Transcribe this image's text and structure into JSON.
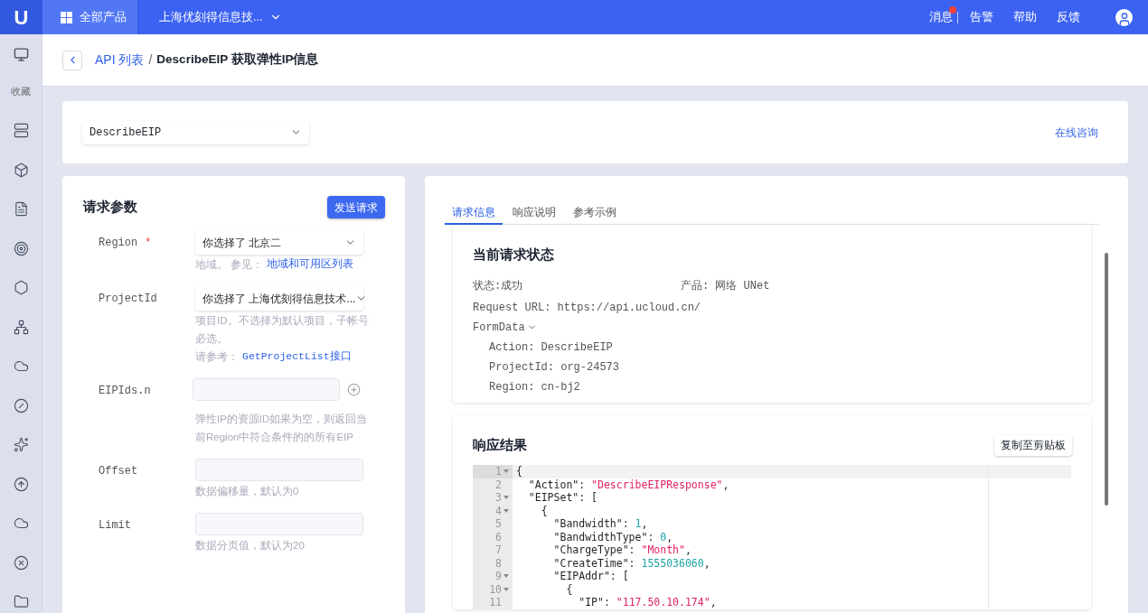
{
  "topbar": {
    "logo": "U",
    "all_products": "全部产品",
    "org": "上海优刻得信息技...",
    "links": [
      {
        "label": "消息",
        "badge": true,
        "divider": true
      },
      {
        "label": "告警",
        "badge": false,
        "divider": false
      },
      {
        "label": "帮助",
        "badge": false,
        "divider": false
      },
      {
        "label": "反馈",
        "badge": false,
        "divider": false
      }
    ]
  },
  "sidebar": {
    "favorites": "收藏"
  },
  "breadcrumb": {
    "parent": "API 列表",
    "separator": "/",
    "current": "DescribeEIP 获取弹性IP信息"
  },
  "api_select": {
    "value": "DescribeEIP"
  },
  "consult_link": "在线咨询",
  "request_params": {
    "title": "请求参数",
    "required_mark": "*",
    "send_button": "发送请求",
    "fields": [
      {
        "kind": "select",
        "label": "Region",
        "required": true,
        "value": "你选择了  北京二",
        "help": [
          {
            "text": "地域。 参见：",
            "link": "地域和可用区列表"
          }
        ]
      },
      {
        "kind": "select",
        "label": "ProjectId",
        "required": false,
        "value": "你选择了  上海优刻得信息技术...",
        "help": [
          {
            "text": "项目ID。不选择为默认项目，子帐号必选。"
          },
          {
            "text": "请参考：",
            "link": "GetProjectList接口"
          }
        ]
      },
      {
        "kind": "list",
        "label": "EIPIds.n",
        "required": false,
        "help": [
          {
            "text": "弹性IP的资源ID如果为空，则返回当前Region中符合条件的的所有EIP"
          }
        ]
      },
      {
        "kind": "input",
        "label": "Offset",
        "required": false,
        "help": [
          {
            "text": "数据偏移量，默认为0"
          }
        ]
      },
      {
        "kind": "input",
        "label": "Limit",
        "required": false,
        "help": [
          {
            "text": "数据分页值，默认为20"
          }
        ]
      }
    ]
  },
  "tabs": [
    {
      "label": "请求信息",
      "selected": true
    },
    {
      "label": "响应说明",
      "selected": false
    },
    {
      "label": "参考示例",
      "selected": false
    }
  ],
  "request_status": {
    "title": "当前请求状态",
    "status": "状态:成功",
    "product": "产品: 网络 UNet",
    "url": "Request URL: https://api.ucloud.cn/",
    "form_data": {
      "label": "FormData",
      "expanded": true,
      "entries": [
        "Action: DescribeEIP",
        "ProjectId: org-24573",
        "Region: cn-bj2"
      ]
    }
  },
  "response": {
    "title": "响应结果",
    "copy_button": "复制至剪贴板",
    "lines": [
      {
        "number": "1",
        "fold": true,
        "active": true,
        "tokens": [
          {
            "kind": "punct",
            "text": "{"
          }
        ]
      },
      {
        "number": "2",
        "fold": false,
        "active": false,
        "tokens": [
          {
            "kind": "punct",
            "text": "  \"Action\": "
          },
          {
            "kind": "string",
            "text": "\"DescribeEIPResponse\""
          },
          {
            "kind": "punct",
            "text": ","
          }
        ]
      },
      {
        "number": "3",
        "fold": true,
        "active": false,
        "tokens": [
          {
            "kind": "punct",
            "text": "  \"EIPSet\": ["
          }
        ]
      },
      {
        "number": "4",
        "fold": true,
        "active": false,
        "tokens": [
          {
            "kind": "punct",
            "text": "    {"
          }
        ]
      },
      {
        "number": "5",
        "fold": false,
        "active": false,
        "tokens": [
          {
            "kind": "punct",
            "text": "      \"Bandwidth\": "
          },
          {
            "kind": "number",
            "text": "1"
          },
          {
            "kind": "punct",
            "text": ","
          }
        ]
      },
      {
        "number": "6",
        "fold": false,
        "active": false,
        "tokens": [
          {
            "kind": "punct",
            "text": "      \"BandwidthType\": "
          },
          {
            "kind": "number",
            "text": "0"
          },
          {
            "kind": "punct",
            "text": ","
          }
        ]
      },
      {
        "number": "7",
        "fold": false,
        "active": false,
        "tokens": [
          {
            "kind": "punct",
            "text": "      \"ChargeType\": "
          },
          {
            "kind": "string",
            "text": "\"Month\""
          },
          {
            "kind": "punct",
            "text": ","
          }
        ]
      },
      {
        "number": "8",
        "fold": false,
        "active": false,
        "tokens": [
          {
            "kind": "punct",
            "text": "      \"CreateTime\": "
          },
          {
            "kind": "number",
            "text": "1555036060"
          },
          {
            "kind": "punct",
            "text": ","
          }
        ]
      },
      {
        "number": "9",
        "fold": true,
        "active": false,
        "tokens": [
          {
            "kind": "punct",
            "text": "      \"EIPAddr\": ["
          }
        ]
      },
      {
        "number": "10",
        "fold": true,
        "active": false,
        "tokens": [
          {
            "kind": "punct",
            "text": "        {"
          }
        ]
      },
      {
        "number": "11",
        "fold": false,
        "active": false,
        "tokens": [
          {
            "kind": "punct",
            "text": "          \"IP\": "
          },
          {
            "kind": "string",
            "text": "\"117.50.10.174\""
          },
          {
            "kind": "punct",
            "text": ","
          }
        ]
      }
    ]
  }
}
